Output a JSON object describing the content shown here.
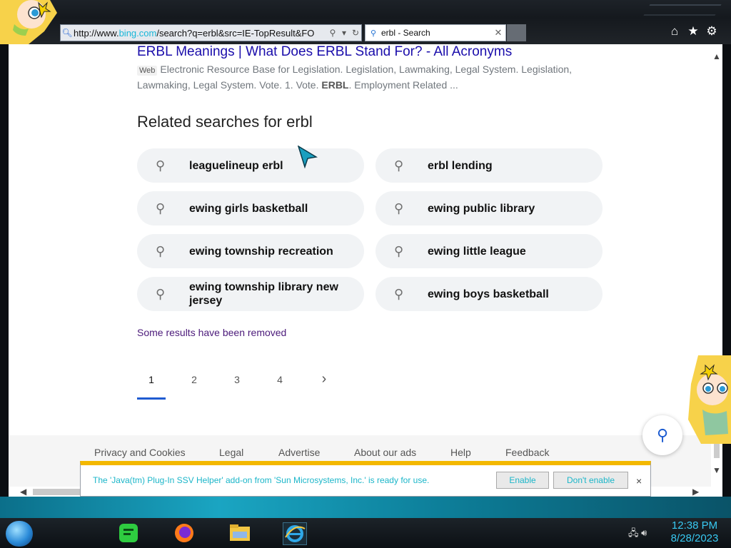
{
  "browser": {
    "address_bar": {
      "url_prefix": "http://www.",
      "url_host": "bing.com",
      "url_rest": "/search?q=erbl&src=IE-TopResult&FO"
    },
    "tab": {
      "label": "erbl - Search"
    },
    "toolbar_icons": [
      "home-icon",
      "star-icon",
      "gear-icon"
    ]
  },
  "result": {
    "title": "ERBL Meanings | What Does ERBL Stand For? - All Acronyms",
    "badge": "Web",
    "snippet_text": "Electronic Resource Base for Legislation. Legislation, Lawmaking, Legal System. Legislation, Lawmaking, Legal System. Vote. 1. Vote. ",
    "snippet_bold": "ERBL",
    "snippet_tail": ". Employment Related ..."
  },
  "related": {
    "heading": "Related searches for erbl",
    "items": [
      "leaguelineup erbl",
      "erbl lending",
      "ewing girls basketball",
      "ewing public library",
      "ewing township recreation",
      "ewing little league",
      "ewing township library new jersey",
      "ewing boys basketball"
    ]
  },
  "removed_notice": "Some results have been removed",
  "pagination": {
    "pages": [
      "1",
      "2",
      "3",
      "4"
    ],
    "current": "1",
    "next": "›"
  },
  "footer": {
    "links": [
      "Privacy and Cookies",
      "Legal",
      "Advertise",
      "About our ads",
      "Help",
      "Feedback"
    ]
  },
  "notification": {
    "message": "The 'Java(tm) Plug-In SSV Helper' add-on from 'Sun Microsystems, Inc.' is ready for use.",
    "enable_label": "Enable",
    "dont_enable_label": "Don't enable",
    "close": "×"
  },
  "taskbar": {
    "time": "12:38 PM",
    "date": "8/28/2023"
  }
}
